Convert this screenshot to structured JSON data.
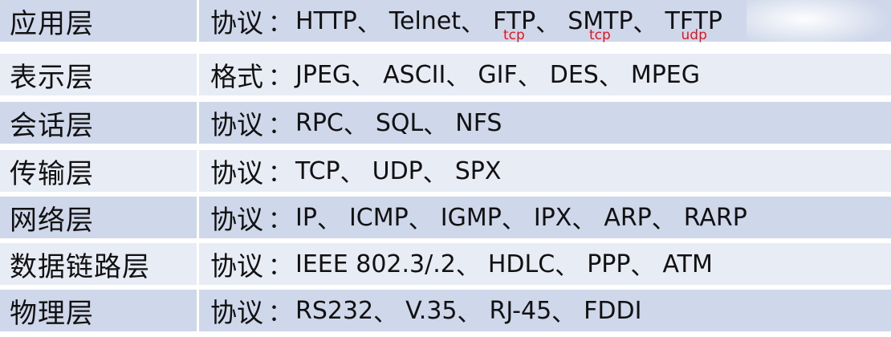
{
  "rows": [
    {
      "layer": "应用层",
      "kind": "协议",
      "items": [
        "HTTP",
        "Telnet",
        "FTP",
        "SMTP",
        "TFTP"
      ],
      "notes": [
        {
          "text": "tcp",
          "under": "FTP"
        },
        {
          "text": "tcp",
          "under": "SMTP"
        },
        {
          "text": "udp",
          "under": "TFTP"
        }
      ]
    },
    {
      "layer": "表示层",
      "kind": "格式",
      "items": [
        "JPEG",
        "ASCII",
        "GIF",
        "DES",
        "MPEG"
      ]
    },
    {
      "layer": "会话层",
      "kind": "协议",
      "items": [
        "RPC",
        "SQL",
        "NFS"
      ]
    },
    {
      "layer": "传输层",
      "kind": "协议",
      "items": [
        "TCP",
        "UDP",
        "SPX"
      ]
    },
    {
      "layer": "网络层",
      "kind": "协议",
      "items": [
        "IP",
        "ICMP",
        "IGMP",
        "IPX",
        "ARP",
        "RARP"
      ]
    },
    {
      "layer": "数据链路层",
      "kind": "协议",
      "items": [
        "IEEE 802.3/.2",
        "HDLC",
        "PPP",
        "ATM"
      ]
    },
    {
      "layer": "物理层",
      "kind": "协议",
      "items": [
        "RS232",
        "V.35",
        "RJ-45",
        "FDDI"
      ]
    }
  ],
  "punctuation": {
    "colon": "：",
    "separator": "、"
  },
  "colors": {
    "row_dark": "#cfd8ea",
    "row_light": "#e8ecf4",
    "note": "#e0141e"
  }
}
